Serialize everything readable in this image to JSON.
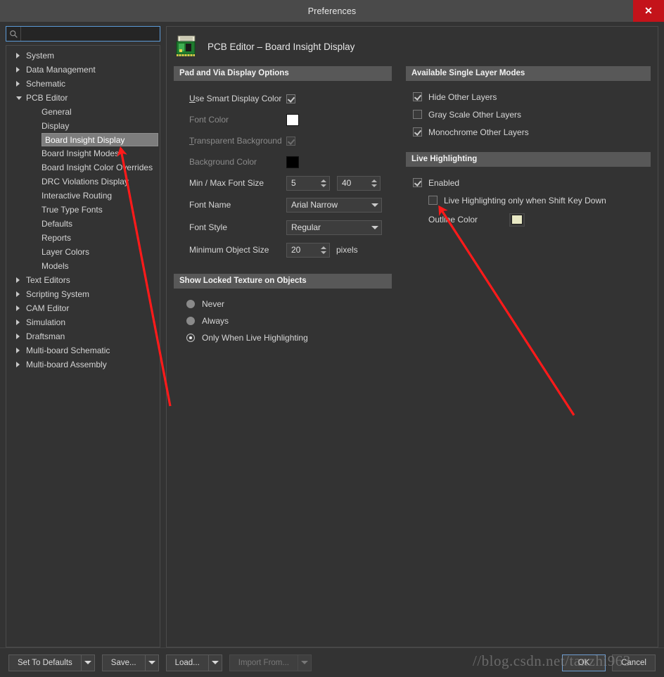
{
  "window": {
    "title": "Preferences",
    "close_label": "✕"
  },
  "search": {
    "placeholder": "",
    "value": "",
    "icon": "search-icon"
  },
  "sidebar": {
    "items": [
      {
        "label": "System",
        "depth": 0,
        "twisty": "right",
        "selected": false
      },
      {
        "label": "Data Management",
        "depth": 0,
        "twisty": "right",
        "selected": false
      },
      {
        "label": "Schematic",
        "depth": 0,
        "twisty": "right",
        "selected": false
      },
      {
        "label": "PCB Editor",
        "depth": 0,
        "twisty": "down",
        "selected": false
      },
      {
        "label": "General",
        "depth": 2,
        "twisty": "none",
        "selected": false
      },
      {
        "label": "Display",
        "depth": 2,
        "twisty": "none",
        "selected": false
      },
      {
        "label": "Board Insight Display",
        "depth": 2,
        "twisty": "none",
        "selected": true
      },
      {
        "label": "Board Insight Modes",
        "depth": 2,
        "twisty": "none",
        "selected": false
      },
      {
        "label": "Board Insight Color Overrides",
        "depth": 2,
        "twisty": "none",
        "selected": false
      },
      {
        "label": "DRC Violations Display",
        "depth": 2,
        "twisty": "none",
        "selected": false
      },
      {
        "label": "Interactive Routing",
        "depth": 2,
        "twisty": "none",
        "selected": false
      },
      {
        "label": "True Type Fonts",
        "depth": 2,
        "twisty": "none",
        "selected": false
      },
      {
        "label": "Defaults",
        "depth": 2,
        "twisty": "none",
        "selected": false
      },
      {
        "label": "Reports",
        "depth": 2,
        "twisty": "none",
        "selected": false
      },
      {
        "label": "Layer Colors",
        "depth": 2,
        "twisty": "none",
        "selected": false
      },
      {
        "label": "Models",
        "depth": 2,
        "twisty": "none",
        "selected": false
      },
      {
        "label": "Text Editors",
        "depth": 0,
        "twisty": "right",
        "selected": false
      },
      {
        "label": "Scripting System",
        "depth": 0,
        "twisty": "right",
        "selected": false
      },
      {
        "label": "CAM Editor",
        "depth": 0,
        "twisty": "right",
        "selected": false
      },
      {
        "label": "Simulation",
        "depth": 0,
        "twisty": "right",
        "selected": false
      },
      {
        "label": "Draftsman",
        "depth": 0,
        "twisty": "right",
        "selected": false
      },
      {
        "label": "Multi-board Schematic",
        "depth": 0,
        "twisty": "right",
        "selected": false
      },
      {
        "label": "Multi-board Assembly",
        "depth": 0,
        "twisty": "right",
        "selected": false
      }
    ]
  },
  "page": {
    "title": "PCB Editor – Board Insight Display",
    "icon": "pcb-board-icon"
  },
  "pad_via": {
    "header": "Pad and Via Display Options",
    "use_smart_display_color": {
      "label_pre": "U",
      "label_post": "se Smart Display Color",
      "checked": true,
      "enabled": true
    },
    "font_color": {
      "label": "Font Color",
      "color": "#ffffff",
      "enabled": false
    },
    "transparent_background": {
      "label_pre": "T",
      "label_post": "ransparent Background",
      "checked": true,
      "enabled": false
    },
    "background_color": {
      "label": "Background Color",
      "color": "#000000",
      "enabled": false
    },
    "min_max_font_size": {
      "label": "Min / Max Font Size",
      "min": "5",
      "max": "40"
    },
    "font_name": {
      "label": "Font Name",
      "value": "Arial Narrow"
    },
    "font_style": {
      "label": "Font Style",
      "value": "Regular"
    },
    "minimum_object_size": {
      "label": "Minimum Object Size",
      "value": "20",
      "unit": "pixels"
    }
  },
  "locked_texture": {
    "header": "Show Locked Texture on Objects",
    "options": [
      {
        "label": "Never",
        "selected": false
      },
      {
        "label": "Always",
        "selected": false
      },
      {
        "label": "Only When Live Highlighting",
        "selected": true
      }
    ]
  },
  "single_layer_modes": {
    "header": "Available Single Layer Modes",
    "options": [
      {
        "label": "Hide Other Layers",
        "checked": true
      },
      {
        "label": "Gray Scale Other Layers",
        "checked": false
      },
      {
        "label": "Monochrome Other Layers",
        "checked": true
      }
    ]
  },
  "live_highlighting": {
    "header": "Live Highlighting",
    "enabled": {
      "label": "Enabled",
      "checked": true
    },
    "shift_key": {
      "label": "Live Highlighting only when Shift Key Down",
      "checked": false
    },
    "outline_color": {
      "label": "Outline Color",
      "color": "#e8e8c4"
    }
  },
  "footer": {
    "set_to_defaults": "Set To Defaults",
    "save": "Save...",
    "load": "Load...",
    "import_from": "Import From...",
    "ok": "OK",
    "cancel": "Cancel"
  },
  "watermark": {
    "text": "//blog.csdn.net/tanzhi963"
  },
  "colors": {
    "window_bg": "#333333",
    "titlebar_bg": "#4a4a4a",
    "close_btn": "#c4131a",
    "section_header_bg": "#585858",
    "selection_bg": "#7d7d7d",
    "focus_border": "#5c9ad6",
    "annotation_arrow": "#ff1a1a"
  }
}
